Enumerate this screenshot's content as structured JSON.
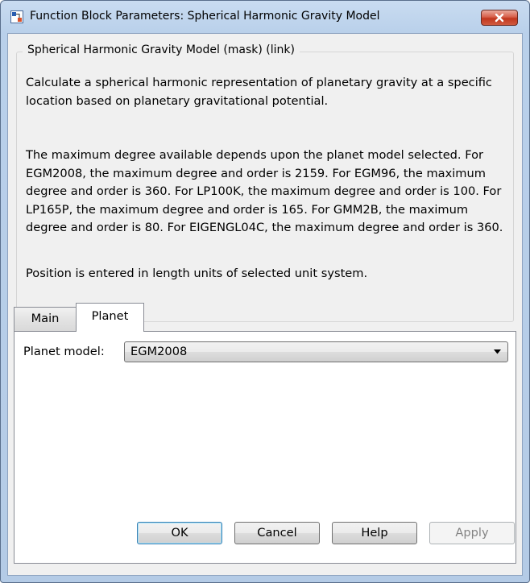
{
  "window": {
    "title": "Function Block Parameters: Spherical Harmonic Gravity Model"
  },
  "group": {
    "legend": "Spherical Harmonic Gravity Model (mask) (link)",
    "paragraphs": [
      "Calculate a spherical harmonic representation of planetary gravity at a specific location based on planetary gravitational potential.",
      "The maximum degree available depends upon the planet model selected.  For EGM2008, the maximum degree and order is 2159.  For EGM96, the maximum degree and order is 360.  For LP100K, the maximum degree and order is 100.  For LP165P, the maximum degree and order is 165.  For GMM2B, the maximum degree and order is 80.  For EIGENGL04C, the maximum degree and order is 360.",
      "Position is entered in length units of selected unit system."
    ]
  },
  "tabs": [
    {
      "label": "Main",
      "active": false
    },
    {
      "label": "Planet",
      "active": true
    }
  ],
  "planet_tab": {
    "planet_model_label": "Planet model:",
    "planet_model_value": "EGM2008"
  },
  "buttons": {
    "ok": "OK",
    "cancel": "Cancel",
    "help": "Help",
    "apply": "Apply"
  },
  "colors": {
    "title_bar": "#b9d0ea",
    "close_button": "#c1361d",
    "dialog_background": "#f0f0f0",
    "default_button_border": "#3c7fb1"
  },
  "icons": {
    "app": "simulink-block-icon",
    "close": "close-x-icon",
    "dropdown": "chevron-down-icon"
  }
}
